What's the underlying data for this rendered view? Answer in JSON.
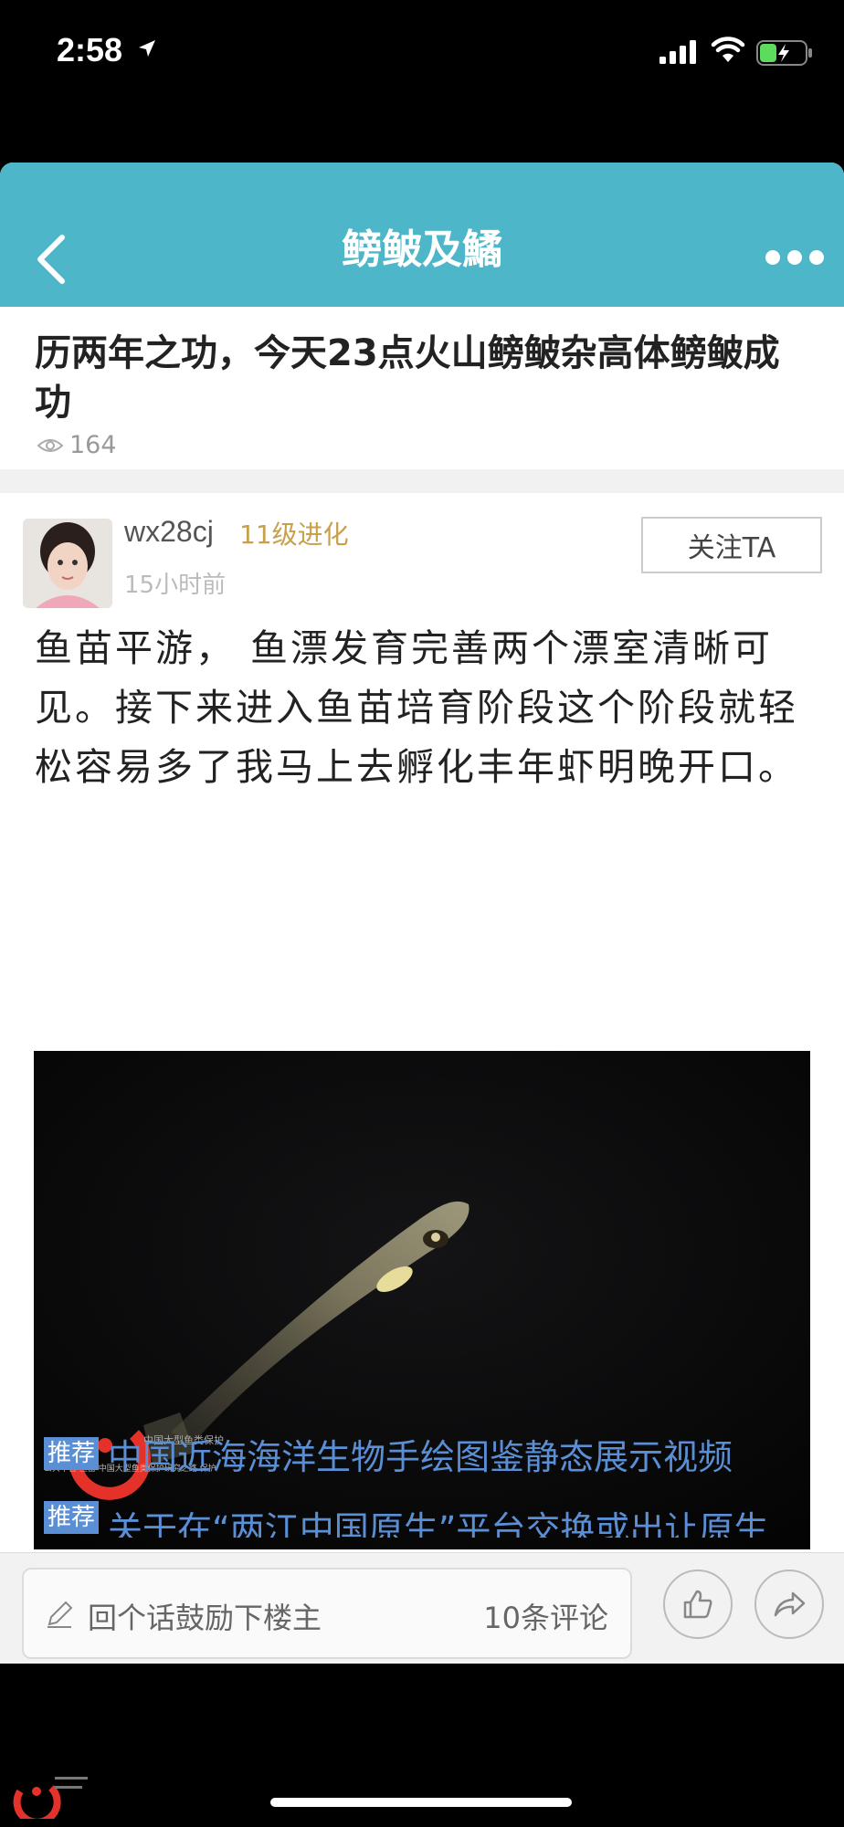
{
  "status": {
    "time": "2:58"
  },
  "nav": {
    "title": "鳑鲏及鱊",
    "back_icon": "chevron-left-icon",
    "more_icon": "more-dots-icon"
  },
  "post": {
    "title": "历两年之功，今天23点火山鳑鲏杂高体鳑鲏成功",
    "views": "164"
  },
  "reply": {
    "username": "wx28cj",
    "level": "11级进化",
    "time": "15小时前",
    "follow_label": "关注TA",
    "body": "鱼苗平游， 鱼漂发育完善两个漂室清晰可见。接下来进入鱼苗培育阶段这个阶段就轻松容易多了我马上去孵化丰年虾明晚开口。",
    "photo_watermark": "公共平台 鱼苗 中国大型鱼类保护研究之路 保护"
  },
  "recommendations": [
    {
      "tag": "推荐",
      "text": "中国近海海洋生物手绘图鉴静态展示视频"
    },
    {
      "tag": "推荐",
      "text": "关于在“两江中国原生”平台交换或出让原生"
    }
  ],
  "bottom_bar": {
    "comment_placeholder": "回个话鼓励下楼主",
    "comment_count": "10条评论",
    "like_icon": "thumbs-up-icon",
    "share_icon": "share-icon"
  },
  "colors": {
    "nav_bg": "#4db6c8",
    "level": "#c9a04a",
    "link": "#5a8fd6"
  }
}
